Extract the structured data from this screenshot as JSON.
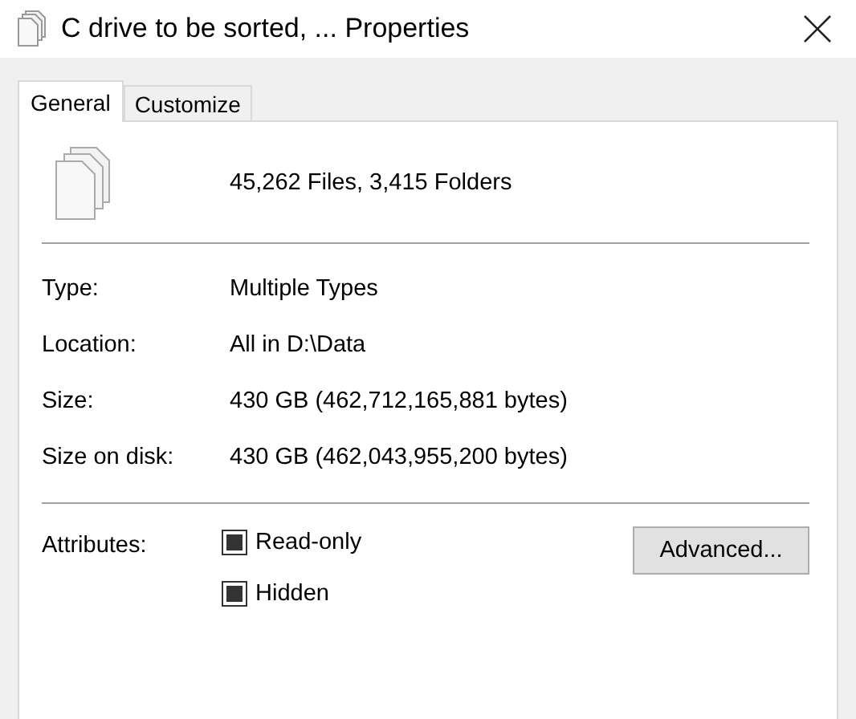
{
  "window": {
    "title": "C drive to be sorted, ... Properties"
  },
  "tabs": [
    {
      "label": "General",
      "selected": true
    },
    {
      "label": "Customize",
      "selected": false
    }
  ],
  "summary": "45,262 Files, 3,415 Folders",
  "properties": [
    {
      "label": "Type:",
      "value": "Multiple Types"
    },
    {
      "label": "Location:",
      "value": "All in D:\\Data"
    },
    {
      "label": "Size:",
      "value": "430 GB (462,712,165,881 bytes)"
    },
    {
      "label": "Size on disk:",
      "value": "430 GB (462,043,955,200 bytes)"
    }
  ],
  "attributes": {
    "label": "Attributes:",
    "options": [
      {
        "label": "Read-only",
        "indeterminate": true
      },
      {
        "label": "Hidden",
        "indeterminate": true
      }
    ],
    "button": "Advanced..."
  }
}
